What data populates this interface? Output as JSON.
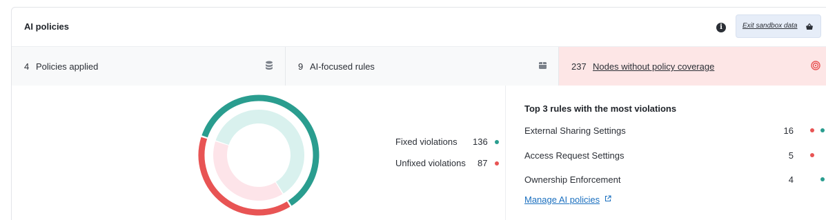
{
  "card": {
    "title": "AI policies",
    "info_icon": "info-icon",
    "sandbox_button": {
      "label": "Exit sandbox data",
      "icon": "basket-icon"
    }
  },
  "stats": [
    {
      "count": "4",
      "label": "Policies applied",
      "icon": "database-icon"
    },
    {
      "count": "9",
      "label": "AI-focused rules",
      "icon": "box-icon"
    },
    {
      "count": "237",
      "label": "Nodes without policy coverage",
      "icon": "target-icon"
    }
  ],
  "chart_data": {
    "type": "pie",
    "categories": [
      "Fixed violations",
      "Unfixed violations"
    ],
    "values": [
      136,
      87
    ],
    "colors": [
      "#2a9d8f",
      "#e85454"
    ],
    "legend": "right"
  },
  "legend": {
    "fixed": {
      "label": "Fixed violations",
      "value": "136"
    },
    "unfixed": {
      "label": "Unfixed violations",
      "value": "87"
    }
  },
  "top_rules": {
    "title": "Top 3 rules with the most violations",
    "rules": [
      {
        "name": "External Sharing Settings",
        "count": "16",
        "unfixed": true,
        "fixed": true
      },
      {
        "name": "Access Request Settings",
        "count": "5",
        "unfixed": true,
        "fixed": false
      },
      {
        "name": "Ownership Enforcement",
        "count": "4",
        "unfixed": false,
        "fixed": true
      }
    ],
    "manage_link": "Manage AI policies"
  },
  "colors": {
    "fixed": "#2a9d8f",
    "unfixed": "#e85454",
    "fixed_light": "#d9f1ee",
    "unfixed_light": "#fde4e9",
    "link": "#1a6fbf"
  }
}
